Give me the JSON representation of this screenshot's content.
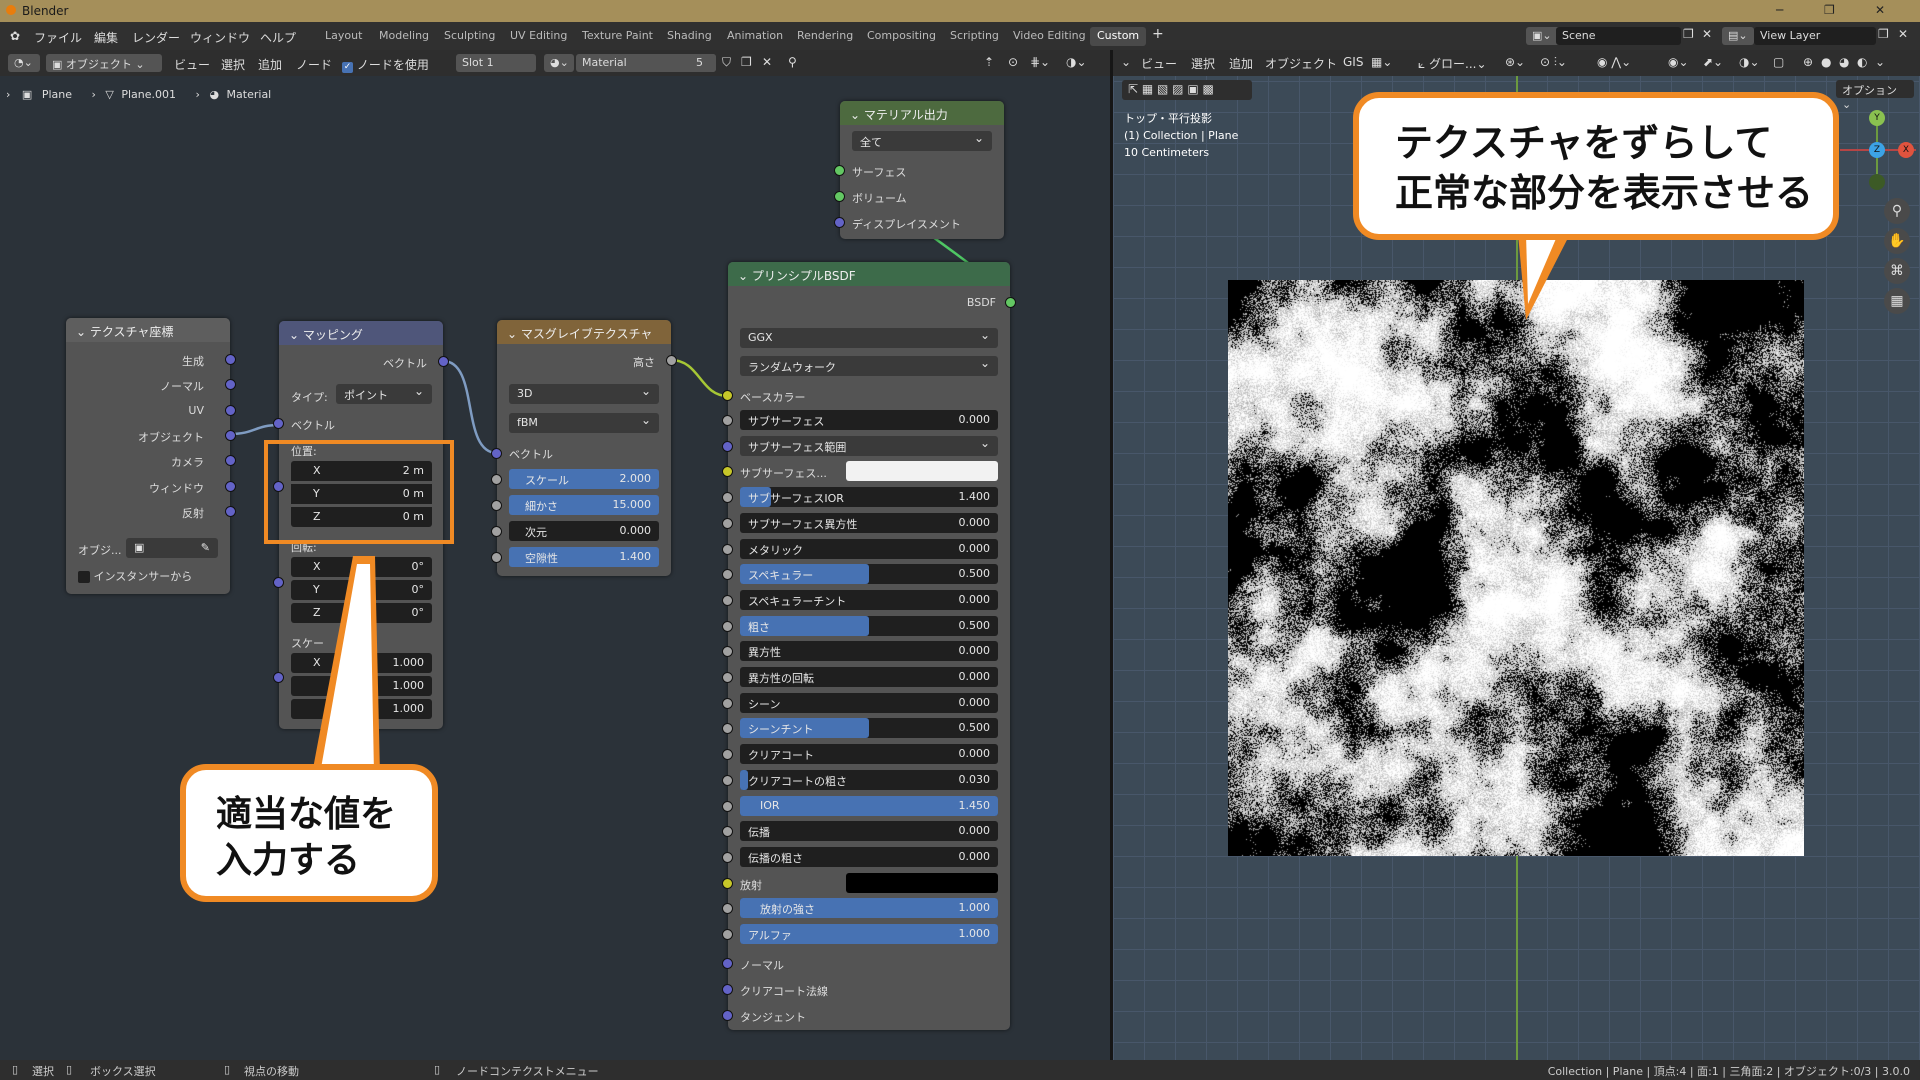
{
  "app": {
    "title": "Blender"
  },
  "menus": [
    "ファイル",
    "編集",
    "レンダー",
    "ウィンドウ",
    "ヘルプ"
  ],
  "workspaces": [
    "Layout",
    "Modeling",
    "Sculpting",
    "UV Editing",
    "Texture Paint",
    "Shading",
    "Animation",
    "Rendering",
    "Compositing",
    "Scripting",
    "Video Editing",
    "Custom"
  ],
  "active_workspace": "Custom",
  "scene": {
    "label": "Scene",
    "view_layer": "View Layer"
  },
  "node_header": {
    "mode": "オブジェクト",
    "menus": [
      "ビュー",
      "選択",
      "追加",
      "ノード"
    ],
    "use_nodes": "ノードを使用",
    "slot": "Slot 1",
    "material": "Material",
    "users": "5"
  },
  "breadcrumb": [
    "Plane",
    "Plane.001",
    "Material"
  ],
  "nodes": {
    "texcoord": {
      "title": "テクスチャ座標",
      "outputs": [
        "生成",
        "ノーマル",
        "UV",
        "オブジェクト",
        "カメラ",
        "ウィンドウ",
        "反射"
      ],
      "object_label": "オブジ...",
      "from_instancer": "インスタンサーから"
    },
    "mapping": {
      "title": "マッピング",
      "out_vector": "ベクトル",
      "type_label": "タイプ:",
      "type_value": "ポイント",
      "in_vector": "ベクトル",
      "location_label": "位置:",
      "location": [
        {
          "axis": "X",
          "value": "2 m"
        },
        {
          "axis": "Y",
          "value": "0 m"
        },
        {
          "axis": "Z",
          "value": "0 m"
        }
      ],
      "rotation_label": "回転:",
      "rotation": [
        {
          "axis": "X",
          "value": "0°"
        },
        {
          "axis": "Y",
          "value": "0°"
        },
        {
          "axis": "Z",
          "value": "0°"
        }
      ],
      "scale_label": "スケー",
      "scale": [
        {
          "axis": "X",
          "value": "1.000"
        },
        {
          "axis": "",
          "value": "1.000"
        },
        {
          "axis": "",
          "value": "1.000"
        }
      ]
    },
    "musgrave": {
      "title": "マスグレイブテクスチャ",
      "out_height": "高さ",
      "dimensions": "3D",
      "type": "fBM",
      "in_vector": "ベクトル",
      "fields": [
        {
          "label": "スケール",
          "value": "2.000"
        },
        {
          "label": "細かさ",
          "value": "15.000"
        },
        {
          "label": "次元",
          "value": "0.000"
        },
        {
          "label": "空隙性",
          "value": "1.400"
        }
      ]
    },
    "output": {
      "title": "マテリアル出力",
      "target": "全て",
      "inputs": [
        "サーフェス",
        "ボリューム",
        "ディスプレイスメント"
      ]
    },
    "bsdf": {
      "title": "プリンシプルBSDF",
      "out": "BSDF",
      "distribution": "GGX",
      "subsurface_method": "ランダムウォーク",
      "base_color": "ベースカラー",
      "rows": [
        {
          "label": "サブサーフェス",
          "value": "0.000",
          "kind": "num",
          "fill": 0
        },
        {
          "label": "サブサーフェス範囲",
          "value": "",
          "kind": "dd",
          "fill": 0
        },
        {
          "label": "サブサーフェス...",
          "value": "",
          "kind": "color",
          "fill": 0
        },
        {
          "label": "サブサーフェスIOR",
          "value": "1.400",
          "kind": "num",
          "fill": 0.12
        },
        {
          "label": "サブサーフェス異方性",
          "value": "0.000",
          "kind": "num",
          "fill": 0
        },
        {
          "label": "メタリック",
          "value": "0.000",
          "kind": "num",
          "fill": 0
        },
        {
          "label": "スペキュラー",
          "value": "0.500",
          "kind": "num",
          "fill": 0.5
        },
        {
          "label": "スペキュラーチント",
          "value": "0.000",
          "kind": "num",
          "fill": 0
        },
        {
          "label": "粗さ",
          "value": "0.500",
          "kind": "num",
          "fill": 0.5
        },
        {
          "label": "異方性",
          "value": "0.000",
          "kind": "num",
          "fill": 0
        },
        {
          "label": "異方性の回転",
          "value": "0.000",
          "kind": "num",
          "fill": 0
        },
        {
          "label": "シーン",
          "value": "0.000",
          "kind": "num",
          "fill": 0
        },
        {
          "label": "シーンチント",
          "value": "0.500",
          "kind": "num",
          "fill": 0.5
        },
        {
          "label": "クリアコート",
          "value": "0.000",
          "kind": "num",
          "fill": 0
        },
        {
          "label": "クリアコートの粗さ",
          "value": "0.030",
          "kind": "num",
          "fill": 0.03
        },
        {
          "label": "IOR",
          "value": "1.450",
          "kind": "num",
          "fill": 1
        },
        {
          "label": "伝播",
          "value": "0.000",
          "kind": "num",
          "fill": 0
        },
        {
          "label": "伝播の粗さ",
          "value": "0.000",
          "kind": "num",
          "fill": 0
        },
        {
          "label": "放射",
          "value": "",
          "kind": "emis",
          "fill": 0
        },
        {
          "label": "放射の強さ",
          "value": "1.000",
          "kind": "num",
          "fill": 1
        },
        {
          "label": "アルファ",
          "value": "1.000",
          "kind": "num",
          "fill": 1
        }
      ],
      "bottom": [
        "ノーマル",
        "クリアコート法線",
        "タンジェント"
      ]
    }
  },
  "viewport": {
    "menus": [
      "ビュー",
      "選択",
      "追加",
      "オブジェクト",
      "GIS"
    ],
    "orientation": "グロー...",
    "options": "オプション",
    "info": [
      "トップ・平行投影",
      "(1) Collection | Plane",
      "10 Centimeters"
    ]
  },
  "callouts": {
    "input_values": "適当な値を\n入力する",
    "shift_texture": "テクスチャをずらして\n正常な部分を表示させる"
  },
  "status": {
    "left": [
      "選択",
      "ボックス選択",
      "視点の移動",
      "ノードコンテクストメニュー"
    ],
    "right": "Collection | Plane | 頂点:4 | 面:1 | 三角面:2 | オブジェクト:0/3 | 3.0.0"
  },
  "colors": {
    "accent": "#f08a24",
    "field_fill": "#4772b3"
  }
}
